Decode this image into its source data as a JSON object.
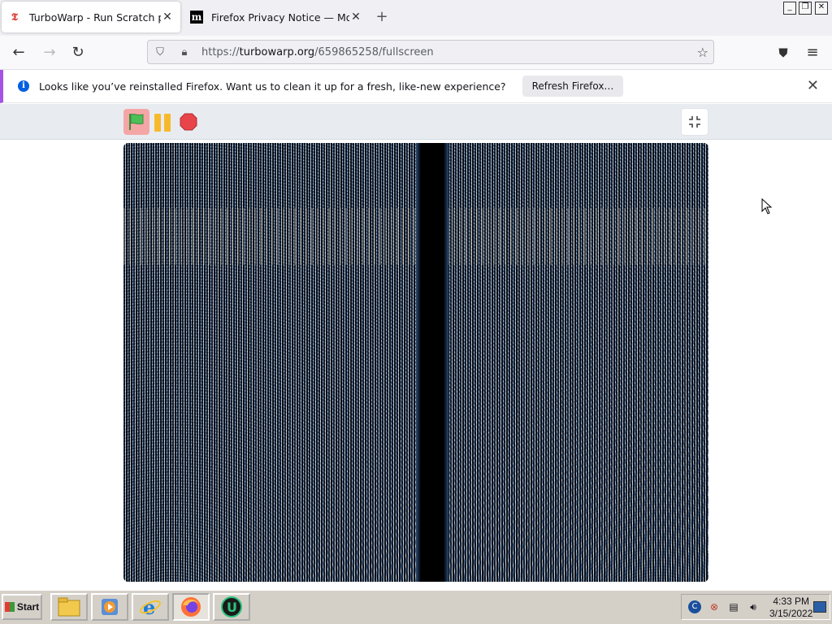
{
  "browser": {
    "tabs": [
      {
        "title": "TurboWarp - Run Scratch proje",
        "active": true,
        "favicon": "turbowarp-icon"
      },
      {
        "title": "Firefox Privacy Notice — Mozilla",
        "active": false,
        "favicon": "mozilla-m-icon"
      }
    ],
    "new_tab": "+",
    "url": {
      "prefix": "https://",
      "host": "turbowarp.org",
      "path": "/659865258/fullscreen"
    }
  },
  "notification": {
    "message": "Looks like you’ve reinstalled Firefox. Want us to clean it up for a fresh, like-new experience?",
    "button": "Refresh Firefox…"
  },
  "player": {
    "controls": [
      "green-flag-icon",
      "pause-icon",
      "stop-icon"
    ],
    "exit_fullscreen": "exit-fullscreen-icon"
  },
  "taskbar": {
    "start": "Start",
    "apps": [
      "file-explorer",
      "media-player",
      "internet-explorer",
      "firefox",
      "turbowarp"
    ],
    "time": "4:33 PM",
    "date": "3/15/2022"
  },
  "colors": {
    "accent": "#0060df",
    "notification_stripe": "#a552e5",
    "flag_bg": "#f4a6a6",
    "pause": "#f7b92c",
    "stop": "#e8454b"
  }
}
